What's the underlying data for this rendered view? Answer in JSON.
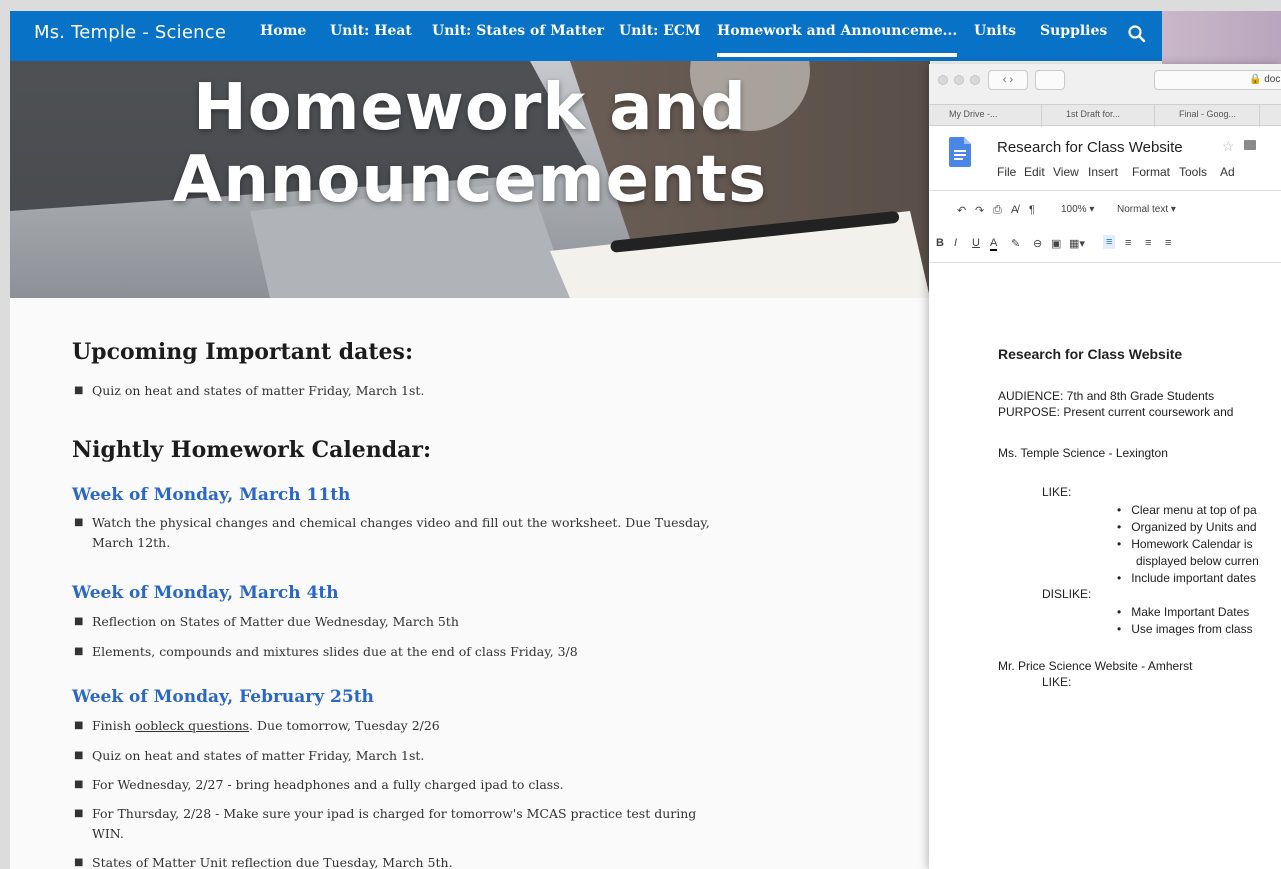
{
  "nav": {
    "brand": "Ms. Temple - Science",
    "items": [
      "Home",
      "Unit: Heat",
      "Unit: States of Matter",
      "Unit: ECM",
      "Homework and Announceme...",
      "Units",
      "Supplies"
    ]
  },
  "hero": {
    "line1": "Homework and",
    "line2": "Announcements"
  },
  "content": {
    "h_dates": "Upcoming Important dates:",
    "dates": [
      "Quiz on heat and states of matter Friday, March 1st."
    ],
    "h_calendar": "Nightly Homework Calendar:",
    "weeks": [
      {
        "title": "Week of Monday, March 11th",
        "items": [
          "Watch the physical changes and chemical changes video and fill out the worksheet.  Due Tuesday, March 12th."
        ]
      },
      {
        "title": "Week of Monday, March 4th",
        "items": [
          " Reflection on States of Matter due Wednesday, March 5th",
          "Elements, compounds and mixtures slides due at the end of class Friday, 3/8"
        ]
      },
      {
        "title": "Week of Monday, February 25th",
        "items": [
          "Finish ",
          "oobleck questions",
          ".  Due tomorrow, Tuesday 2/26",
          "Quiz on heat and states of matter Friday, March 1st.",
          "For Wednesday, 2/27 - bring headphones and a fully charged ipad to class.",
          "For Thursday, 2/28 - Make sure your ipad is charged for tomorrow's MCAS practice test during WIN.",
          "States of Matter Unit reflection due Tuesday, March 5th."
        ]
      }
    ]
  },
  "browser": {
    "url": "doc",
    "tabs": [
      "My Drive -...",
      "1st Draft for...",
      "Final - Goog..."
    ]
  },
  "doc": {
    "title": "Research for Class Website",
    "menu": [
      "File",
      "Edit",
      "View",
      "Insert",
      "Format",
      "Tools",
      "Ad"
    ],
    "zoom": "100%",
    "style": "Normal text",
    "heading": "Research for Class Website",
    "audience": "AUDIENCE: 7th and 8th Grade Students",
    "purpose": "PURPOSE: Present current coursework and",
    "site1": "Ms. Temple Science - Lexington",
    "like": "LIKE:",
    "likes": [
      "Clear menu at top of pa",
      "Organized by Units and",
      "Homework Calendar is",
      "displayed below curren",
      "Include important dates"
    ],
    "dislike": "DISLIKE:",
    "dislikes": [
      "Make Important Dates",
      "Use images from class"
    ],
    "site2": "Mr. Price Science Website - Amherst",
    "like2": "LIKE:"
  }
}
